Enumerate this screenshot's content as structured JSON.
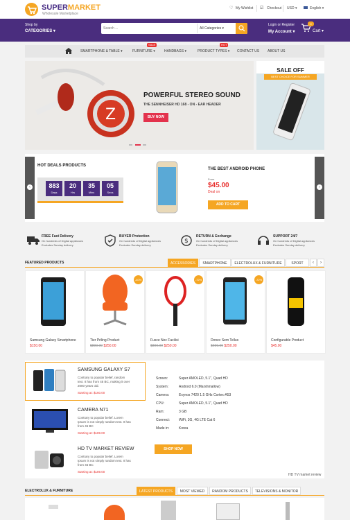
{
  "header": {
    "logo_main_1": "SUPER",
    "logo_main_2": "MARKET",
    "logo_sub": "Wholesale Marketplace",
    "my_wishlist": "My Wishlist",
    "checkout": "Checkout",
    "currency": "USD",
    "language": "English"
  },
  "nav": {
    "shop_by": "Shop by",
    "categories": "CATEGORIES",
    "search": {
      "placeholder": "Search ...",
      "category": "All Categories"
    },
    "login_register": "Login or Register",
    "my_account": "My Account",
    "cart_label": "Cart",
    "cart_count": "0"
  },
  "menu": {
    "items": [
      "SMARTPHONE & TABLE",
      "FURNITURE",
      "HANDBAGS",
      "PRODUCT TYPES",
      "CONTACT US",
      "ABOUT US"
    ],
    "furniture_tag": "SALE",
    "product_types_tag": "HOT"
  },
  "hero": {
    "title": "POWERFUL STEREO SOUND",
    "subtitle": "THE SENNHEISER HD 168 - ON - EAR HEADER",
    "button": "BUY NOW",
    "slide_count": 3,
    "active_slide": 2
  },
  "side_banner": {
    "title": "SALE OFF",
    "subtitle": "BEST CHOICE FOR SUMMER"
  },
  "hot_deals": {
    "title": "HOT DEALS PRODUCTS",
    "countdown": [
      {
        "value": "883",
        "unit": "Days"
      },
      {
        "value": "20",
        "unit": "Hrs"
      },
      {
        "value": "35",
        "unit": "Mins"
      },
      {
        "value": "05",
        "unit": "Secs"
      }
    ],
    "product_name": "THE BEST ANDROID PHONE",
    "from_label": "From",
    "price": "$45.00",
    "deal_label": "Deal on",
    "button": "ADD TO CART"
  },
  "services": [
    {
      "title": "FREE Fast Delivery",
      "line1": "On hundreds of Digital appliances",
      "line2": "Excludes Sunday delivery"
    },
    {
      "title": "BUYER Protection",
      "line1": "On hundreds of Digital appliances",
      "line2": "Excludes Sunday delivery"
    },
    {
      "title": "RETURN & Exchange",
      "line1": "On hundreds of Digital appliances",
      "line2": "Excludes Sunday delivery"
    },
    {
      "title": "SUPPORT 24/7",
      "line1": "On hundreds of Digital appliances",
      "line2": "Excludes Sunday delivery"
    }
  ],
  "featured": {
    "title": "FEATURED PRODUCTS",
    "tabs": [
      "ACCESSORIES",
      "SMARTPHONE",
      "ELECTROLUX & FURNITURE",
      "SPORT"
    ],
    "products": [
      {
        "name": "Samsung Galaxy Smartphone",
        "price": "$150.00",
        "old": "",
        "badge": ""
      },
      {
        "name": "Tier Priling Product",
        "price": "$250.00",
        "old": "$890.00",
        "badge": "-40%"
      },
      {
        "name": "Fusce Nec Facilisi",
        "price": "$250.00",
        "old": "$890.00",
        "badge": "-72%"
      },
      {
        "name": "Donec Sem Tellus",
        "price": "$250.00",
        "old": "$690.00",
        "badge": "-72%"
      },
      {
        "name": "Configurable Product",
        "price": "$45.00",
        "old": "",
        "badge": ""
      }
    ]
  },
  "compare": {
    "items": [
      {
        "title": "SAMSUNG GALAXY S7",
        "desc1": "Contrary to popular belief, random",
        "desc2": "text. It has from 45 BC, making it over",
        "desc3": "2000 years old.",
        "starting": "Starting at: $160.00"
      },
      {
        "title": "CAMERA N71",
        "desc1": "Contrary to popular belief. Lorem",
        "desc2": "Ipsum is not simply random text. It has",
        "desc3": "from 45 BC",
        "starting": "Starting at: $189.00"
      },
      {
        "title": "HD TV MARKET REVIEW",
        "desc1": "Contrary to popular belief. Lorem",
        "desc2": "Ipsum is not simply random text. It has",
        "desc3": "from 45 BC",
        "starting": "Starting at: $189.00"
      }
    ],
    "specs": [
      {
        "label": "Screen:",
        "value": "Super AMOLED, 5.1\", Quad HD"
      },
      {
        "label": "System:",
        "value": "Android 6.0 (Marshmallow)"
      },
      {
        "label": "Camera:",
        "value": "Exynos 7420 1.5 GHz Cortex-A53"
      },
      {
        "label": "CPU:",
        "value": "Super AMOLED, 5.1\", Quad HD"
      },
      {
        "label": "Ram:",
        "value": "3 GB"
      },
      {
        "label": "Connect:",
        "value": "WiFi, 3G, 4G LTE Cat 6"
      },
      {
        "label": "Made in:",
        "value": "Korea"
      }
    ],
    "button": "SHOP NOW",
    "image_alt": "HD TV market review"
  },
  "bottom": {
    "title": "ELECTROLUX & FURNITURE",
    "tabs": [
      "LATEST PRODUCTS",
      "MOST VIEWED",
      "RANDOM PRODUCTS",
      "TELEVISIONS & MONITOR"
    ]
  },
  "colors": {
    "accent": "#f5a623",
    "brand": "#4a2d7e",
    "price": "#e8312f",
    "hero_button": "#e3324c"
  }
}
